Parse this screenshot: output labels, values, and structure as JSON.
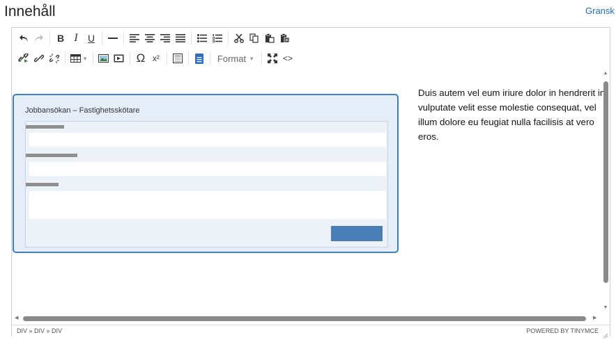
{
  "page": {
    "title": "Innehåll",
    "preview_link": "Gransk"
  },
  "toolbar": {
    "row1": [
      "undo-icon",
      "redo-icon",
      "bold-icon",
      "italic-icon",
      "underline-icon",
      "horizontal-rule-icon",
      "align-left-icon",
      "align-center-icon",
      "align-right-icon",
      "align-justify-icon",
      "bullet-list-icon",
      "numbered-list-icon",
      "cut-icon",
      "copy-icon",
      "paste-icon",
      "paste-text-icon"
    ],
    "row2": [
      "link-special-icon",
      "link-icon",
      "unlink-icon",
      "table-icon",
      "image-icon",
      "media-icon",
      "special-char-icon",
      "superscript-icon",
      "template-icon",
      "document-icon",
      "fullscreen-icon",
      "source-code-icon"
    ],
    "bold_label": "B",
    "italic_label": "I",
    "underline_label": "U",
    "omega_label": "Ω",
    "superscript_label": "x²",
    "code_label": "<>",
    "format_label": "Format"
  },
  "content": {
    "widget_title": "Jobbansökan – Fastighetsskötare",
    "body_text": "Duis autem vel eum iriure dolor in hendrerit in vulputate velit esse molestie consequat, vel illum dolore eu feugiat nulla facilisis at vero eros."
  },
  "statusbar": {
    "path": "DIV » DIV » DIV",
    "branding": "POWERED BY TINYMCE"
  },
  "colors": {
    "accent": "#3d7fbf",
    "widget_bg": "#e5eef8",
    "submit": "#4a7fb6",
    "link": "#1b6fb5"
  }
}
